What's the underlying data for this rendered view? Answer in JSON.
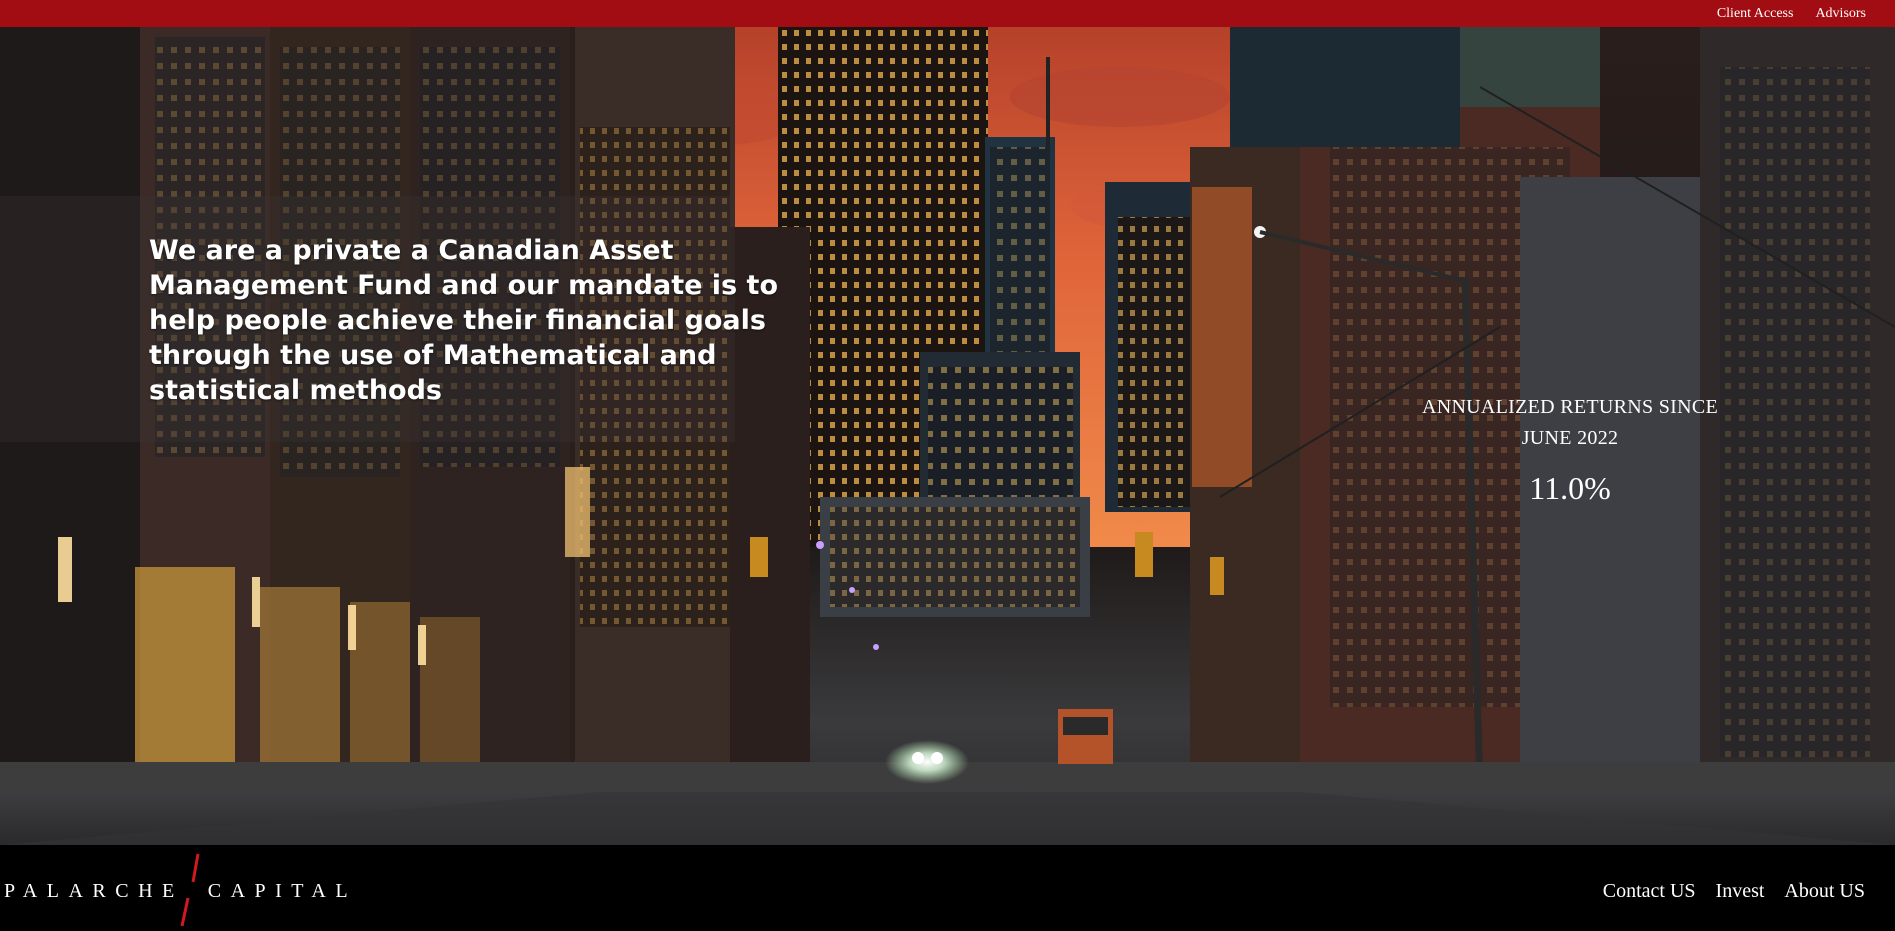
{
  "topbar": {
    "links": [
      {
        "label": "Client Access"
      },
      {
        "label": "Advisors"
      }
    ],
    "color": "#a10d12"
  },
  "hero": {
    "headline": "We are a private a Canadian Asset Management Fund and our mandate is to help people achieve their financial goals through the use of Mathematical and statistical methods",
    "returns": {
      "label_line1": "ANNUALIZED RETURNS SINCE",
      "label_line2": "JUNE 2022",
      "value": "11.0%"
    }
  },
  "footer": {
    "logo_left": "PALARCHE",
    "logo_right": "CAPITAL",
    "links": [
      {
        "label": "Contact US"
      },
      {
        "label": "Invest"
      },
      {
        "label": "About US"
      }
    ]
  },
  "colors": {
    "brand_red": "#a10d12",
    "logo_slash": "#d21920"
  }
}
